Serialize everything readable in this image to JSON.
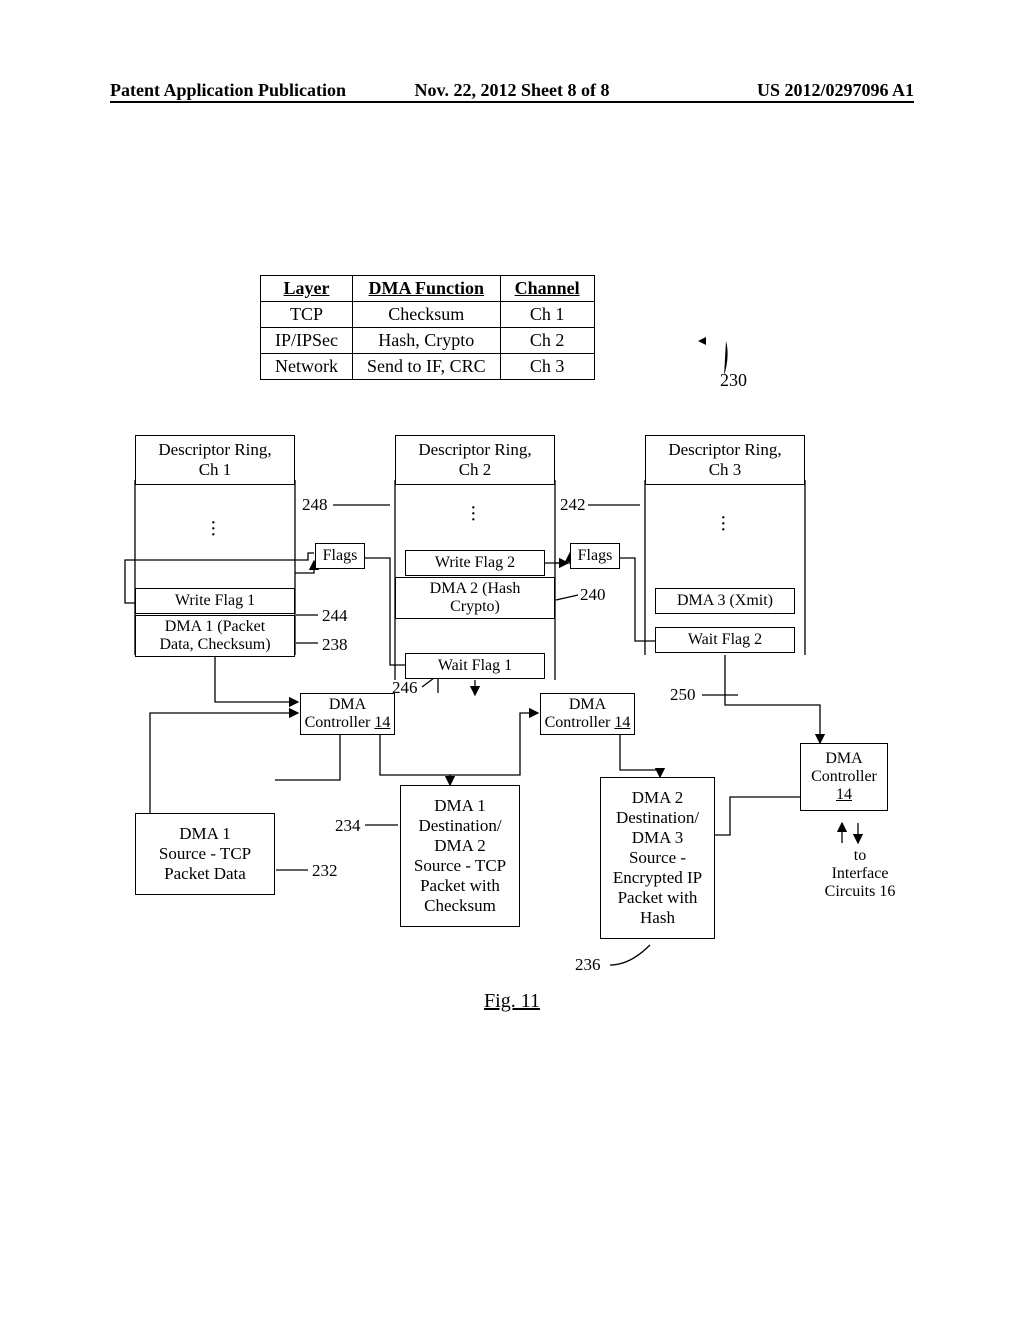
{
  "header": {
    "left": "Patent Application Publication",
    "center": "Nov. 22, 2012  Sheet 8 of 8",
    "right": "US 2012/0297096 A1"
  },
  "table": {
    "headers": [
      "Layer",
      "DMA Function",
      "Channel"
    ],
    "rows": [
      [
        "TCP",
        "Checksum",
        "Ch 1"
      ],
      [
        "IP/IPSec",
        "Hash, Crypto",
        "Ch 2"
      ],
      [
        "Network",
        "Send to IF, CRC",
        "Ch 3"
      ]
    ]
  },
  "ref230": "230",
  "rings": {
    "ch1": {
      "title": "Descriptor Ring,\nCh 1",
      "writeflag": "Write Flag 1",
      "dma": "DMA 1 (Packet\nData, Checksum)"
    },
    "ch2": {
      "title": "Descriptor Ring,\nCh 2",
      "flags": "Flags",
      "writeflag": "Write Flag 2",
      "dma": "DMA 2 (Hash\nCrypto)",
      "waitflag": "Wait Flag 1"
    },
    "ch3": {
      "title": "Descriptor Ring,\nCh 3",
      "flags": "Flags",
      "dma": "DMA 3 (Xmit)",
      "waitflag": "Wait Flag 2"
    }
  },
  "flagsLbl": "Flags",
  "dmaController": "DMA\nController ",
  "dmaControllerNum": "14",
  "dmaControllerMulti": "DMA\nController",
  "boxes": {
    "box232": "DMA 1\nSource - TCP\nPacket Data",
    "box234": "DMA 1\nDestination/\nDMA 2\nSource - TCP\nPacket with\nChecksum",
    "box236": "DMA 2\nDestination/\nDMA 3\nSource -\nEncrypted IP\nPacket with\nHash",
    "toif": "to\nInterface\nCircuits 16"
  },
  "refs": {
    "r248": "248",
    "r242": "242",
    "r244": "244",
    "r238": "238",
    "r240": "240",
    "r246": "246",
    "r250": "250",
    "r232": "232",
    "r234": "234",
    "r236": "236"
  },
  "figLabel": "Fig. 11"
}
